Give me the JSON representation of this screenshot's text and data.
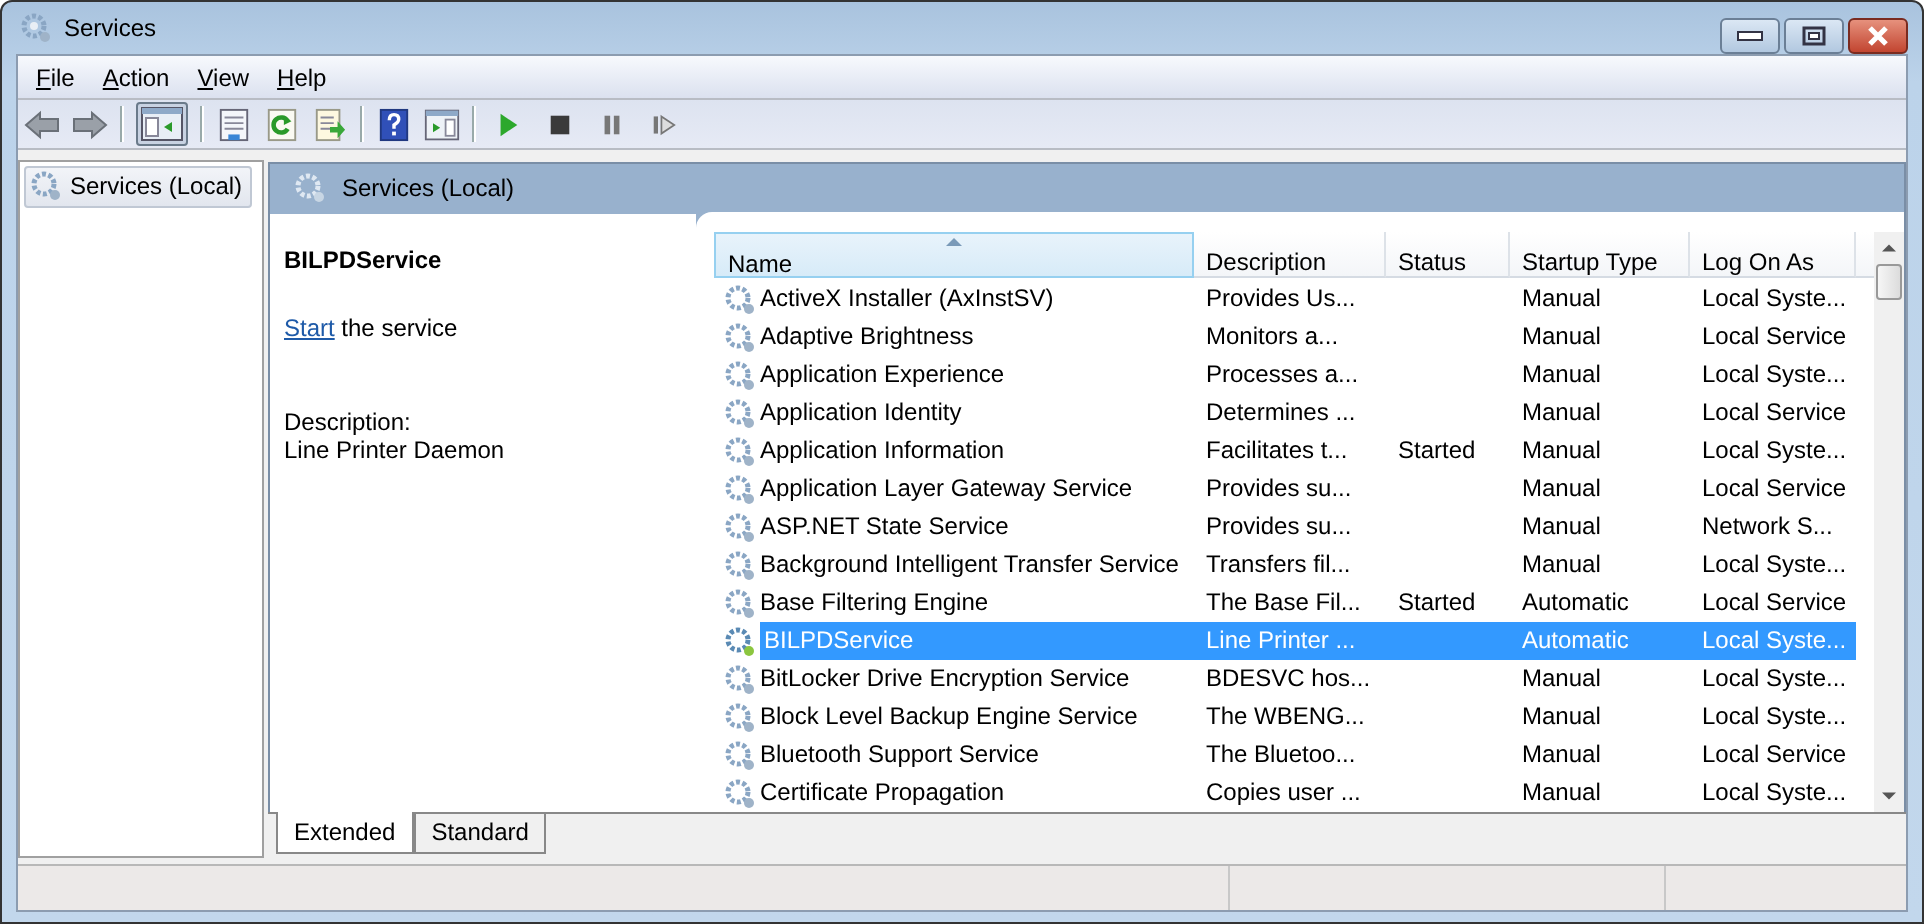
{
  "window": {
    "title": "Services"
  },
  "menu": [
    {
      "label": "File"
    },
    {
      "label": "Action"
    },
    {
      "label": "View"
    },
    {
      "label": "Help"
    }
  ],
  "tree": {
    "items": [
      {
        "label": "Services (Local)",
        "selected": true
      }
    ]
  },
  "header": {
    "title": "Services (Local)"
  },
  "details": {
    "name": "BILPDService",
    "link": "Start",
    "action_rest": " the service",
    "description_label": "Description:",
    "description": "Line Printer Daemon"
  },
  "table": {
    "columns": [
      {
        "label": "Name",
        "sorted": true
      },
      {
        "label": "Description",
        "sorted": false
      },
      {
        "label": "Status",
        "sorted": false
      },
      {
        "label": "Startup Type",
        "sorted": false
      },
      {
        "label": "Log On As",
        "sorted": false
      }
    ],
    "rows": [
      {
        "cells": [
          "ActiveX Installer (AxInstSV)",
          "Provides Us...",
          "",
          "Manual",
          "Local Syste..."
        ],
        "selected": false
      },
      {
        "cells": [
          "Adaptive Brightness",
          "Monitors a...",
          "",
          "Manual",
          "Local Service"
        ],
        "selected": false
      },
      {
        "cells": [
          "Application Experience",
          "Processes a...",
          "",
          "Manual",
          "Local Syste..."
        ],
        "selected": false
      },
      {
        "cells": [
          "Application Identity",
          "Determines ...",
          "",
          "Manual",
          "Local Service"
        ],
        "selected": false
      },
      {
        "cells": [
          "Application Information",
          "Facilitates t...",
          "Started",
          "Manual",
          "Local Syste..."
        ],
        "selected": false
      },
      {
        "cells": [
          "Application Layer Gateway Service",
          "Provides su...",
          "",
          "Manual",
          "Local Service"
        ],
        "selected": false
      },
      {
        "cells": [
          "ASP.NET State Service",
          "Provides su...",
          "",
          "Manual",
          "Network S..."
        ],
        "selected": false
      },
      {
        "cells": [
          "Background Intelligent Transfer Service",
          "Transfers fil...",
          "",
          "Manual",
          "Local Syste..."
        ],
        "selected": false
      },
      {
        "cells": [
          "Base Filtering Engine",
          "The Base Fil...",
          "Started",
          "Automatic",
          "Local Service"
        ],
        "selected": false
      },
      {
        "cells": [
          "BILPDService",
          "Line Printer ...",
          "",
          "Automatic",
          "Local Syste..."
        ],
        "selected": true
      },
      {
        "cells": [
          "BitLocker Drive Encryption Service",
          "BDESVC hos...",
          "",
          "Manual",
          "Local Syste..."
        ],
        "selected": false
      },
      {
        "cells": [
          "Block Level Backup Engine Service",
          "The WBENG...",
          "",
          "Manual",
          "Local Syste..."
        ],
        "selected": false
      },
      {
        "cells": [
          "Bluetooth Support Service",
          "The Bluetoo...",
          "",
          "Manual",
          "Local Service"
        ],
        "selected": false
      },
      {
        "cells": [
          "Certificate Propagation",
          "Copies user ...",
          "",
          "Manual",
          "Local Syste..."
        ],
        "selected": false
      }
    ]
  },
  "tabs": [
    {
      "label": "Extended",
      "selected": true
    },
    {
      "label": "Standard",
      "selected": false
    }
  ]
}
